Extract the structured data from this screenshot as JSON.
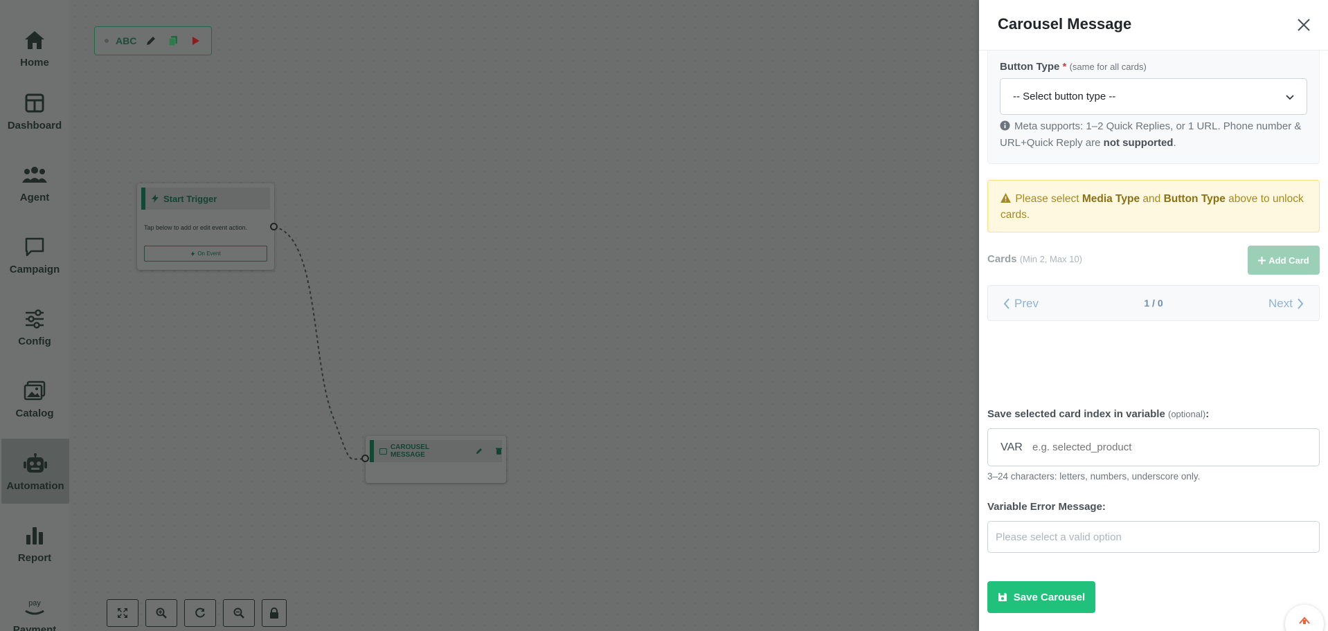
{
  "sidebar": {
    "items": [
      {
        "label": "Home",
        "icon": "home-icon"
      },
      {
        "label": "Dashboard",
        "icon": "dashboard-icon"
      },
      {
        "label": "Agent",
        "icon": "users-icon"
      },
      {
        "label": "Campaign",
        "icon": "chat-icon"
      },
      {
        "label": "Config",
        "icon": "sliders-icon"
      },
      {
        "label": "Catalog",
        "icon": "image-icon"
      },
      {
        "label": "Automation",
        "icon": "robot-icon",
        "active": true
      },
      {
        "label": "Report",
        "icon": "bar-chart-icon"
      },
      {
        "label": "Payment",
        "icon": "pay-icon"
      }
    ]
  },
  "canvas": {
    "flow_name": "ABC",
    "start_node": {
      "title": "Start Trigger",
      "description": "Tap below to add or edit event action.",
      "event_button": "On Event"
    },
    "carousel_node": {
      "title": "CAROUSEL MESSAGE"
    }
  },
  "panel": {
    "title": "Carousel Message",
    "button_type": {
      "label": "Button Type",
      "required_mark": "*",
      "hint": "(same for all cards)",
      "selected": "-- Select button type --",
      "info_text": "Meta supports: 1–2 Quick Replies, or 1 URL. Phone number & URL+Quick Reply are",
      "info_bold": "not supported",
      "info_end": "."
    },
    "warning": {
      "prefix": "Please select",
      "media_type": "Media Type",
      "and": "and",
      "button_type": "Button Type",
      "suffix": "above to unlock cards."
    },
    "cards": {
      "label": "Cards",
      "hint": "(Min 2, Max 10)",
      "add_button": "Add Card",
      "prev": "Prev",
      "next": "Next",
      "count": "1 / 0"
    },
    "variable": {
      "label": "Save selected card index in variable",
      "optional": "(optional)",
      "colon": ":",
      "prefix": "VAR",
      "placeholder": "e.g. selected_product",
      "help": "3–24 characters: letters, numbers, underscore only."
    },
    "error_message": {
      "label": "Variable Error Message:",
      "placeholder": "Please select a valid option"
    },
    "save_button": "Save Carousel"
  },
  "colors": {
    "accent": "#20c17a",
    "warning_bg": "#fff8e1",
    "overlay": "#6b6e6d"
  }
}
